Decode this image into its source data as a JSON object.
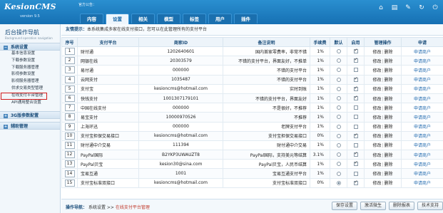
{
  "header": {
    "brand": "KesionCMS",
    "version": "version 9.5",
    "notice": "官方公告：",
    "tabs": [
      "内容",
      "设置",
      "相关",
      "模型",
      "标签",
      "用户",
      "插件"
    ],
    "active_tab_index": 1,
    "icons": [
      "home-icon",
      "list-icon",
      "tools-icon",
      "refresh-icon",
      "power-icon"
    ]
  },
  "sidebar": {
    "title": "后台操作导航",
    "subtitle": "Background operation navigation",
    "sections": [
      {
        "label": "系统设置",
        "symbol": "−",
        "items": [
          "基本信息设置",
          "下载参数设置",
          "下载服务器管理",
          "影视参数设置",
          "影视服务器管理",
          "供求交易类型管理",
          "在线支付平台管理",
          "API通用整合设置"
        ],
        "highlighted_index": 6
      },
      {
        "label": "3G版参数配置",
        "symbol": "+",
        "items": []
      },
      {
        "label": "辅助管理",
        "symbol": "+",
        "items": []
      }
    ]
  },
  "infobar": {
    "label": "友情提示：",
    "text": "本系统集成多家在线支付接口，您可以在此管理所有的支付平台"
  },
  "table": {
    "headers": [
      "序号",
      "支付平台",
      "商家ID",
      "备注说明",
      "手续费",
      "默认",
      "启用",
      "管理操作",
      "申请"
    ],
    "edit_label": "修改",
    "delete_label": "删除",
    "op_separator": "|",
    "apply_label": "申请商户",
    "rows": [
      {
        "index": "1",
        "name": "财付通",
        "id": "1202640601",
        "desc": "国内首家零费率，非常不错",
        "fee": "1%",
        "default": false,
        "enabled": true
      },
      {
        "index": "2",
        "name": "网银在线",
        "id": "20303579",
        "desc": "不错的支付平台，界面友好，不推单",
        "fee": "1%",
        "default": false,
        "enabled": true
      },
      {
        "index": "3",
        "name": "易付通",
        "id": "000000",
        "desc": "不错的支付平台",
        "fee": "1%",
        "default": false,
        "enabled": false
      },
      {
        "index": "4",
        "name": "云网支付",
        "id": "1035487",
        "desc": "不错的支付平台",
        "fee": "1%",
        "default": false,
        "enabled": true
      },
      {
        "index": "5",
        "name": "支付宝",
        "id": "kesioncms@hotmail.com",
        "desc": "实时到账",
        "fee": "1%",
        "default": false,
        "enabled": true
      },
      {
        "index": "6",
        "name": "快钱支付",
        "id": "1001307179101",
        "desc": "不错的支付平台，界面友好",
        "fee": "1%",
        "default": false,
        "enabled": true
      },
      {
        "index": "7",
        "name": "中国在线支付",
        "id": "000000",
        "desc": "不是很好，不推荐",
        "fee": "1%",
        "default": false,
        "enabled": false
      },
      {
        "index": "8",
        "name": "易宝支付",
        "id": "10000970526",
        "desc": "不推荐",
        "fee": "1%",
        "default": false,
        "enabled": false
      },
      {
        "index": "9",
        "name": "上海环迅",
        "id": "000000",
        "desc": "老牌支付平台",
        "fee": "1%",
        "default": false,
        "enabled": false
      },
      {
        "index": "10",
        "name": "支付宝担保交易接口",
        "id": "kesioncms@hotmail.com",
        "desc": "支付宝担保交易接口",
        "fee": "0%",
        "default": false,
        "enabled": true
      },
      {
        "index": "11",
        "name": "财付通中介交易",
        "id": "111394",
        "desc": "财付通中介交易",
        "fee": "1%",
        "default": false,
        "enabled": false
      },
      {
        "index": "12",
        "name": "PayPal国际",
        "id": "B2YKP3UWAUZT8",
        "desc": "PayPal国际，支持美元等结算",
        "fee": "3.1%",
        "default": false,
        "enabled": true
      },
      {
        "index": "13",
        "name": "PayPal贝宝",
        "id": "kesion30@sina.com",
        "desc": "PayPal贝宝，人民币结算",
        "fee": "1%",
        "default": false,
        "enabled": true
      },
      {
        "index": "14",
        "name": "宝易互通",
        "id": "1001",
        "desc": "宝易互通支付平台",
        "fee": "1%",
        "default": false,
        "enabled": false
      },
      {
        "index": "15",
        "name": "支付宝标准双接口",
        "id": "kesioncms@hotmail.com",
        "desc": "支付宝标准双接口",
        "fee": "0%",
        "default": true,
        "enabled": true
      }
    ]
  },
  "footer": {
    "label": "操作导航：",
    "crumb_root": "系统设置",
    "crumb_sep": ">>",
    "crumb_current": "在线支付平台管理",
    "buttons": [
      "保存设置",
      "激活微生",
      "删除报表",
      "技术支持"
    ]
  }
}
